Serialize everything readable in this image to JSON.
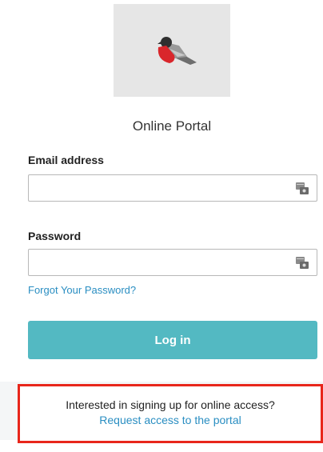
{
  "portal": {
    "title": "Online Portal"
  },
  "login_form": {
    "email_label": "Email address",
    "email_value": "",
    "password_label": "Password",
    "password_value": "",
    "forgot_link": "Forgot Your Password?",
    "login_button": "Log in"
  },
  "signup": {
    "prompt": "Interested in signing up for online access?",
    "request_link": "Request access to the portal"
  },
  "colors": {
    "accent_button": "#53b9c2",
    "link": "#2a8ec2",
    "highlight_border": "#e8261b"
  },
  "icons": {
    "logo": "bullfinch-bird-logo",
    "password_manager": "key-card-icon"
  }
}
